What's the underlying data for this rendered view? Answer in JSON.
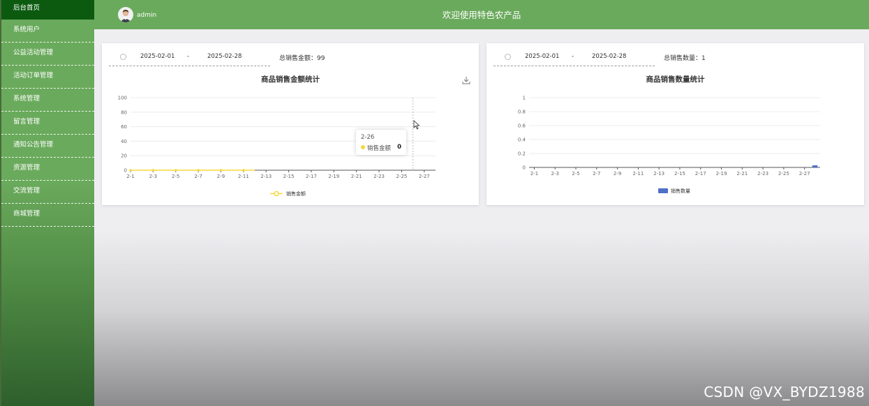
{
  "header": {
    "username": "admin",
    "title": "欢迎使用特色农产品"
  },
  "sidebar": {
    "items": [
      {
        "label": "后台首页"
      },
      {
        "label": "系统用户"
      },
      {
        "label": "公益活动管理"
      },
      {
        "label": "活动订单管理"
      },
      {
        "label": "系统管理"
      },
      {
        "label": "留言管理"
      },
      {
        "label": "通知公告管理"
      },
      {
        "label": "资源管理"
      },
      {
        "label": "交流管理"
      },
      {
        "label": "商城管理"
      }
    ]
  },
  "left_card": {
    "start_date": "2025-02-01",
    "separator": "-",
    "end_date": "2025-02-28",
    "total_label": "总销售金额：99"
  },
  "right_card": {
    "start_date": "2025-02-01",
    "separator": "-",
    "end_date": "2025-02-28",
    "total_label": "总销售数量：1"
  },
  "tooltip": {
    "date": "2-26",
    "series": "销售金额",
    "value": "0"
  },
  "watermark": "CSDN @VX_BYDZ1988",
  "colors": {
    "green": "#6aaa5c",
    "active": "#0b5a10",
    "line": "#f5d83b",
    "bar": "#4f6fc9"
  },
  "chart_data": [
    {
      "type": "line",
      "title": "商品销售金额统计",
      "categories": [
        "2-1",
        "2-2",
        "2-3",
        "2-4",
        "2-5",
        "2-6",
        "2-7",
        "2-8",
        "2-9",
        "2-10",
        "2-11",
        "2-12",
        "2-13",
        "2-14",
        "2-15",
        "2-16",
        "2-17",
        "2-18",
        "2-19",
        "2-20",
        "2-21",
        "2-22",
        "2-23",
        "2-24",
        "2-25",
        "2-26",
        "2-27",
        "2-28"
      ],
      "x_tick_labels": [
        "2-1",
        "2-3",
        "2-5",
        "2-7",
        "2-9",
        "2-11",
        "2-13",
        "2-15",
        "2-17",
        "2-19",
        "2-21",
        "2-23",
        "2-25",
        "2-27"
      ],
      "y_ticks": [
        0,
        20,
        40,
        60,
        80,
        100
      ],
      "ylim": [
        0,
        100
      ],
      "series": [
        {
          "name": "销售金额",
          "values": [
            0,
            0,
            0,
            0,
            0,
            0,
            0,
            0,
            0,
            0,
            0,
            0,
            0,
            0,
            0,
            0,
            0,
            0,
            0,
            0,
            0,
            0,
            0,
            0,
            0,
            0,
            0,
            0
          ]
        }
      ],
      "legend": "bottom-center",
      "grid": true
    },
    {
      "type": "bar",
      "title": "商品销售数量统计",
      "categories": [
        "2-1",
        "2-2",
        "2-3",
        "2-4",
        "2-5",
        "2-6",
        "2-7",
        "2-8",
        "2-9",
        "2-10",
        "2-11",
        "2-12",
        "2-13",
        "2-14",
        "2-15",
        "2-16",
        "2-17",
        "2-18",
        "2-19",
        "2-20",
        "2-21",
        "2-22",
        "2-23",
        "2-24",
        "2-25",
        "2-26",
        "2-27",
        "2-28"
      ],
      "x_tick_labels": [
        "2-1",
        "2-3",
        "2-5",
        "2-7",
        "2-9",
        "2-11",
        "2-13",
        "2-15",
        "2-17",
        "2-19",
        "2-21",
        "2-23",
        "2-25",
        "2-27"
      ],
      "y_ticks": [
        0,
        0.2,
        0.4,
        0.6,
        0.8,
        1
      ],
      "ylim": [
        0,
        1
      ],
      "series": [
        {
          "name": "销售数量",
          "values": [
            0,
            0,
            0,
            0,
            0,
            0,
            0,
            0,
            0,
            0,
            0,
            0,
            0,
            0,
            0,
            0,
            0,
            0,
            0,
            0,
            0,
            0,
            0,
            0,
            0,
            0,
            0,
            0.03
          ]
        }
      ],
      "legend": "bottom-center",
      "grid": true
    }
  ]
}
